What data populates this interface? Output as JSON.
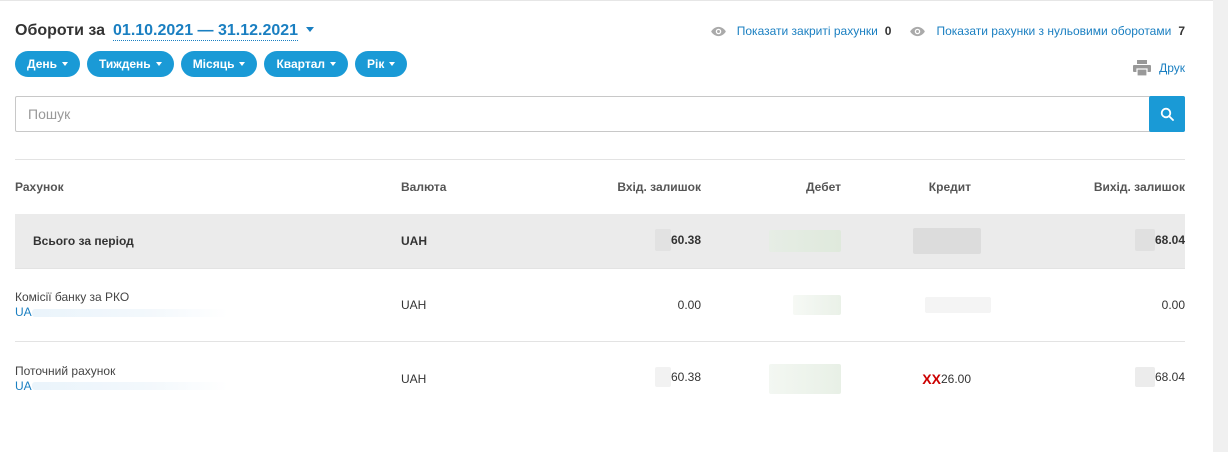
{
  "header": {
    "title": "Обороти за",
    "period": "01.10.2021 — 31.12.2021"
  },
  "filters": [
    "День",
    "Тиждень",
    "Місяць",
    "Квартал",
    "Рік"
  ],
  "links": {
    "closed_label": "Показати закриті рахунки",
    "closed_count": "0",
    "zero_label": "Показати рахунки з нульовими оборотами",
    "zero_count": "7",
    "print_label": "Друк"
  },
  "search": {
    "placeholder": "Пошук",
    "value": ""
  },
  "table": {
    "columns": [
      "Рахунок",
      "Валюта",
      "Вхід. залишок",
      "Дебет",
      "Кредит",
      "Вихід. залишок"
    ],
    "total": {
      "label": "Всього за період",
      "currency": "UAH",
      "opening": "60.38",
      "closing": "68.04"
    },
    "rows": [
      {
        "name": "Комісії банку за РКО",
        "iban": "UA",
        "currency": "UAH",
        "opening": "0.00",
        "credit": "",
        "closing": "0.00"
      },
      {
        "name": "Поточний рахунок",
        "iban": "UA",
        "currency": "UAH",
        "opening": "60.38",
        "credit_prefix": "XX",
        "credit": "26.00",
        "closing": "68.04"
      }
    ]
  },
  "colors": {
    "accent": "#1a9ad6",
    "link": "#1a7fc1",
    "total_bg": "#ebebeb"
  }
}
